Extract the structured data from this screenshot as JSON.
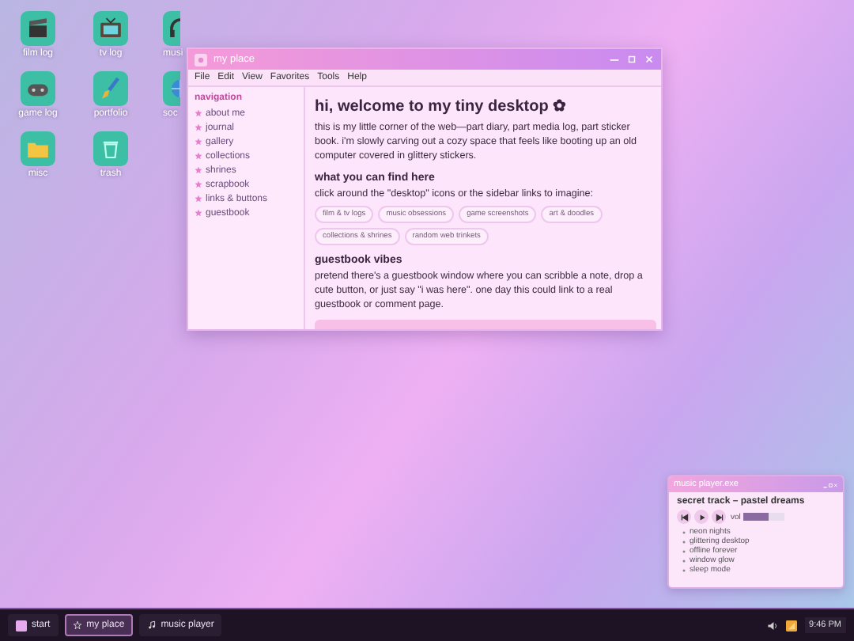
{
  "desktop_icons": [
    {
      "label": "film log",
      "kind": "film"
    },
    {
      "label": "tv log",
      "kind": "tv"
    },
    {
      "label": "musi",
      "kind": "headphones"
    },
    {
      "label": "game log",
      "kind": "gamepad"
    },
    {
      "label": "portfolio",
      "kind": "brush"
    },
    {
      "label": "soc",
      "kind": "globe"
    },
    {
      "label": "misc",
      "kind": "folder"
    },
    {
      "label": "trash",
      "kind": "trash"
    }
  ],
  "window": {
    "title": "my place",
    "menu": [
      "File",
      "Edit",
      "View",
      "Favorites",
      "Tools",
      "Help"
    ],
    "sidebar": {
      "heading": "navigation",
      "items": [
        "about me",
        "journal",
        "gallery",
        "collections",
        "shrines",
        "scrapbook",
        "links & buttons",
        "guestbook"
      ]
    },
    "content": {
      "title": "hi, welcome to my tiny desktop ✿",
      "intro": "this is my little corner of the web—part diary, part media log, part sticker book. i'm slowly carving out a cozy space that feels like booting up an old computer covered in glittery stickers.",
      "sections": [
        {
          "heading": "what you can find here",
          "text": "click around the \"desktop\" icons or the sidebar links to imagine:",
          "tags": [
            "film & tv logs",
            "music obsessions",
            "game screenshots",
            "art & doodles",
            "collections & shrines",
            "random web trinkets"
          ]
        },
        {
          "heading": "guestbook vibes",
          "text": "pretend there's a guestbook window where you can scribble a note, drop a cute button, or just say \"i was here\". one day this could link to a real guestbook or comment page."
        }
      ]
    }
  },
  "music_player": {
    "title": "music player.exe",
    "track": "secret track – pastel dreams",
    "volume_label": "vol",
    "volume": {
      "level": 0.6
    },
    "playlist": [
      "neon nights",
      "glittering desktop",
      "offline forever",
      "window glow",
      "sleep mode"
    ]
  },
  "taskbar": {
    "start": "start",
    "tasks": [
      {
        "label": "my place",
        "kind": "star",
        "selected": true
      },
      {
        "label": "music player",
        "kind": "note",
        "selected": false
      }
    ],
    "clock": "9:46 PM"
  }
}
